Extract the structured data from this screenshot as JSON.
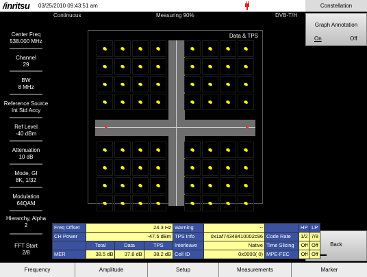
{
  "header": {
    "brand": "/inritsu",
    "timestamp": "03/25/2010 09:43:51 am",
    "mode": "Continuous",
    "measuring": "Measuring  90%",
    "standard": "DVB-T/H"
  },
  "left_panel": [
    {
      "label": "Center Freq",
      "value": "538.000 MHz"
    },
    {
      "label": "Channel",
      "value": "29"
    },
    {
      "label": "BW",
      "value": "8 MHz"
    },
    {
      "label": "Reference Source",
      "value": "Int Std Accy"
    },
    {
      "label": "Ref Level",
      "value": "-40 dBm"
    },
    {
      "label": "Attenuation",
      "value": "10 dB"
    },
    {
      "label": "Mode, GI",
      "value": "8K, 1/32"
    },
    {
      "label": "Modulation",
      "value": "64QAM"
    },
    {
      "label": "Hierarchy, Alpha",
      "value": "2"
    },
    {
      "label": "FFT Start",
      "value": "2/8"
    }
  ],
  "plot": {
    "title": "Data & TPS"
  },
  "right_panel": {
    "title": "Constellation",
    "graph_annotation": "Graph Annotation",
    "on_label": "On",
    "off_label": "Off",
    "back_label": "Back"
  },
  "table": {
    "freq_offset_label": "Freq Offset",
    "freq_offset_value": "24.3 Hz",
    "ch_power_label": "CH Power",
    "ch_power_value": "-47.5 dBm",
    "col_total": "Total",
    "col_data": "Data",
    "col_tps": "TPS",
    "mer_label": "MER",
    "mer_total": "38.5 dB",
    "mer_data": "37.8 dB",
    "mer_tps": "38.2 dB",
    "warning_label": "Warning",
    "warning_value": "--",
    "tps_info_label": "TPS Info",
    "tps_info_value": "0x1af74348410002c96",
    "interleave_label": "Interleave",
    "interleave_value": "Native",
    "cell_id_label": "Cell ID",
    "cell_id_value": "0x0000(     0)",
    "code_rate_label": "Code Rate",
    "code_rate_hp": "1/2",
    "code_rate_lp": "7/8",
    "time_slicing_label": "Time Slicing",
    "time_slicing_hp": "Off",
    "time_slicing_lp": "Off",
    "mpe_fec_label": "MPE-FEC",
    "mpe_fec_hp": "Off",
    "mpe_fec_lp": "Off",
    "hp_label": "HP",
    "lp_label": "LP"
  },
  "bottom_menu": [
    "Frequency",
    "Amplitude",
    "Setup",
    "Measurements",
    "Marker"
  ]
}
